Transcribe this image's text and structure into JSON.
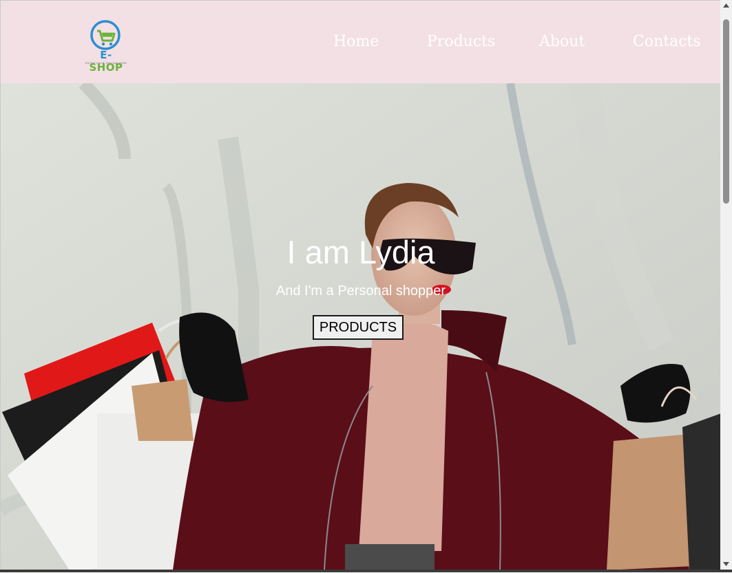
{
  "brand": {
    "name_prefix": "E-",
    "name_suffix": "SHOP",
    "tagline": "ENTER YOUR TAGLINE HERE",
    "icon": "shopping-cart-logo-icon",
    "colors": {
      "blue": "#2b8fd1",
      "green": "#69b33a"
    }
  },
  "nav": {
    "items": [
      {
        "label": "Home"
      },
      {
        "label": "Products"
      },
      {
        "label": "About"
      },
      {
        "label": "Contacts"
      }
    ]
  },
  "hero": {
    "title": "I am Lydia",
    "subtitle": "And I'm a Personal shopper",
    "button_label": "PRODUCTS",
    "image": "woman-with-shopping-bags-photo"
  },
  "colors": {
    "header_bg": "#f3e0e4",
    "nav_text": "#ffffff",
    "hero_text": "#ffffff"
  },
  "scrollbar": {
    "up_icon": "scroll-up-arrow-icon",
    "down_icon": "scroll-down-arrow-icon"
  }
}
